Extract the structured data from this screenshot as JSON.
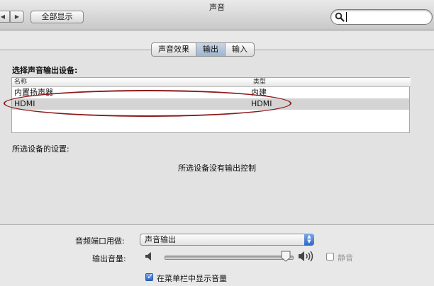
{
  "window": {
    "title": "声音"
  },
  "toolbar": {
    "back_icon": "◀",
    "forward_icon": "▶",
    "show_all": "全部显示",
    "search_value": ""
  },
  "tabs": [
    {
      "label": "声音效果",
      "active": false
    },
    {
      "label": "输出",
      "active": true
    },
    {
      "label": "输入",
      "active": false
    }
  ],
  "output": {
    "select_label": "选择声音输出设备:",
    "columns": {
      "name": "名称",
      "type": "类型"
    },
    "devices": [
      {
        "name": "内置扬声器",
        "type": "内建",
        "selected": false
      },
      {
        "name": "HDMI",
        "type": "HDMI",
        "selected": true
      }
    ],
    "settings_label": "所选设备的设置:",
    "no_controls": "所选设备没有输出控制"
  },
  "bottom": {
    "port_label": "音频端口用做:",
    "port_value": "声音输出",
    "volume_label": "输出音量:",
    "volume_level": 0.95,
    "mute_label": "静音",
    "mute_checked": false,
    "menubar_label": "在菜单栏中显示音量",
    "menubar_checked": true
  },
  "colors": {
    "highlight_ellipse": "#8b1a1a",
    "accent": "#2a66c9"
  }
}
